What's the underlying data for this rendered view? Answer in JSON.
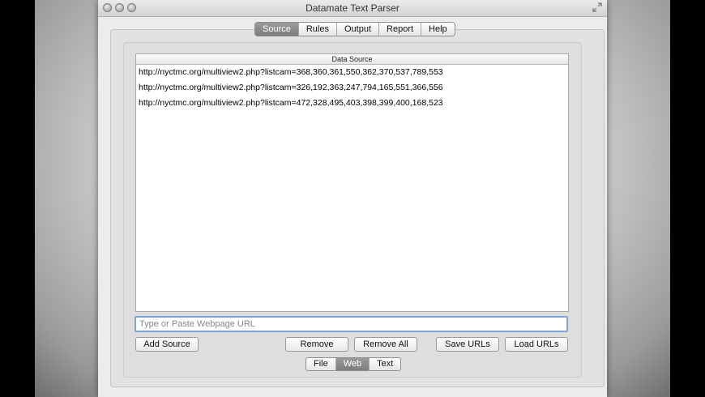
{
  "window": {
    "title": "Datamate Text Parser"
  },
  "tabs": [
    {
      "label": "Source",
      "active": true
    },
    {
      "label": "Rules",
      "active": false
    },
    {
      "label": "Output",
      "active": false
    },
    {
      "label": "Report",
      "active": false
    },
    {
      "label": "Help",
      "active": false
    }
  ],
  "data_source": {
    "header": "Data Source",
    "rows": [
      "http://nyctmc.org/multiview2.php?listcam=368,360,361,550,362,370,537,789,553",
      "http://nyctmc.org/multiview2.php?listcam=326,192,363,247,794,165,551,366,556",
      "http://nyctmc.org/multiview2.php?listcam=472,328,495,403,398,399,400,168,523"
    ]
  },
  "url_input": {
    "placeholder": "Type or Paste Webpage URL",
    "value": ""
  },
  "buttons": {
    "add_source": "Add Source",
    "remove": "Remove",
    "remove_all": "Remove All",
    "save_urls": "Save URLs",
    "load_urls": "Load URLs"
  },
  "source_type_tabs": [
    {
      "label": "File",
      "active": false
    },
    {
      "label": "Web",
      "active": true
    },
    {
      "label": "Text",
      "active": false
    }
  ],
  "icons": {
    "close": "close-icon",
    "minimize": "minimize-icon",
    "zoom": "zoom-icon",
    "fullscreen": "fullscreen-icon"
  }
}
